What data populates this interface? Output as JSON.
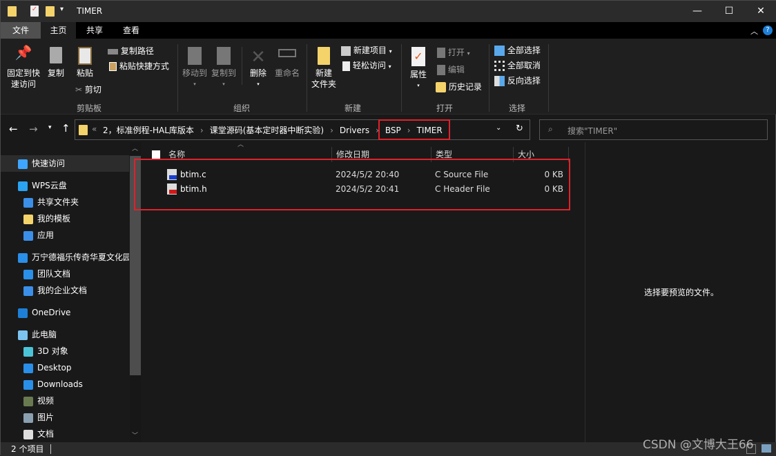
{
  "window": {
    "title": "TIMER",
    "min": "—",
    "max": "☐",
    "close": "✕"
  },
  "tabs": [
    {
      "label": "文件"
    },
    {
      "label": "主页"
    },
    {
      "label": "共享"
    },
    {
      "label": "查看"
    }
  ],
  "ribbon": {
    "clipboard": {
      "pin": "固定到快",
      "pin2": "速访问",
      "copy": "复制",
      "paste": "粘贴",
      "copy_path": "复制路径",
      "paste_shortcut": "粘贴快捷方式",
      "cut": "剪切",
      "group": "剪贴板"
    },
    "organize": {
      "move_to": "移动到",
      "copy_to": "复制到",
      "delete": "删除",
      "rename": "重命名",
      "group": "组织"
    },
    "new": {
      "new_folder": "新建",
      "new_folder2": "文件夹",
      "new_item": "新建项目",
      "easy_access": "轻松访问",
      "group": "新建"
    },
    "open": {
      "properties": "属性",
      "open": "打开",
      "edit": "编辑",
      "history": "历史记录",
      "group": "打开"
    },
    "select": {
      "select_all": "全部选择",
      "select_none": "全部取消",
      "invert": "反向选择",
      "group": "选择"
    }
  },
  "address": {
    "overflow": "«",
    "crumbs": [
      "2，标准例程-HAL库版本",
      "课堂源码(基本定时器中断实验)",
      "Drivers",
      "BSP",
      "TIMER"
    ],
    "search_placeholder": "搜索\"TIMER\""
  },
  "nav": [
    {
      "label": "快速访问",
      "icon": "star-icon",
      "color": "#3ea6ff",
      "indent": 0,
      "selected": true
    },
    {
      "label": "WPS云盘",
      "icon": "cloud-icon",
      "color": "#2aa3f0",
      "indent": 0
    },
    {
      "label": "共享文件夹",
      "icon": "share-icon",
      "color": "#3b8fe8",
      "indent": 1
    },
    {
      "label": "我的模板",
      "icon": "folder-icon",
      "color": "#f5d36b",
      "indent": 1
    },
    {
      "label": "应用",
      "icon": "apps-icon",
      "color": "#3b8fe8",
      "indent": 1
    },
    {
      "label": "万宁德福乐传奇华夏文化园",
      "icon": "wps-org-icon",
      "color": "#2a8fe8",
      "indent": 0
    },
    {
      "label": "团队文档",
      "icon": "team-docs-icon",
      "color": "#2a8fe8",
      "indent": 1
    },
    {
      "label": "我的企业文档",
      "icon": "enterprise-docs-icon",
      "color": "#3b8fe8",
      "indent": 1
    },
    {
      "label": "OneDrive",
      "icon": "onedrive-icon",
      "color": "#1e7fd8",
      "indent": 0
    },
    {
      "label": "此电脑",
      "icon": "computer-icon",
      "color": "#7cc4f0",
      "indent": 0
    },
    {
      "label": "3D 对象",
      "icon": "cube-icon",
      "color": "#4cc4d8",
      "indent": 1
    },
    {
      "label": "Desktop",
      "icon": "desktop-icon",
      "color": "#2a8fe8",
      "indent": 1
    },
    {
      "label": "Downloads",
      "icon": "download-icon",
      "color": "#2a8fe8",
      "indent": 1
    },
    {
      "label": "视频",
      "icon": "video-icon",
      "color": "#6a7a50",
      "indent": 1
    },
    {
      "label": "图片",
      "icon": "picture-icon",
      "color": "#8aa0b0",
      "indent": 1
    },
    {
      "label": "文档",
      "icon": "document-icon",
      "color": "#dddddd",
      "indent": 1
    }
  ],
  "columns": {
    "name": "名称",
    "date": "修改日期",
    "type": "类型",
    "size": "大小"
  },
  "files": [
    {
      "name": "btim.c",
      "date": "2024/5/2 20:40",
      "type": "C Source File",
      "size": "0 KB",
      "badge_color": "#1a3fd0"
    },
    {
      "name": "btim.h",
      "date": "2024/5/2 20:41",
      "type": "C Header File",
      "size": "0 KB",
      "badge_color": "#d01a1a"
    }
  ],
  "preview": {
    "text": "选择要预览的文件。"
  },
  "status": {
    "count": "2 个项目"
  },
  "watermark": "CSDN @文博大王66"
}
